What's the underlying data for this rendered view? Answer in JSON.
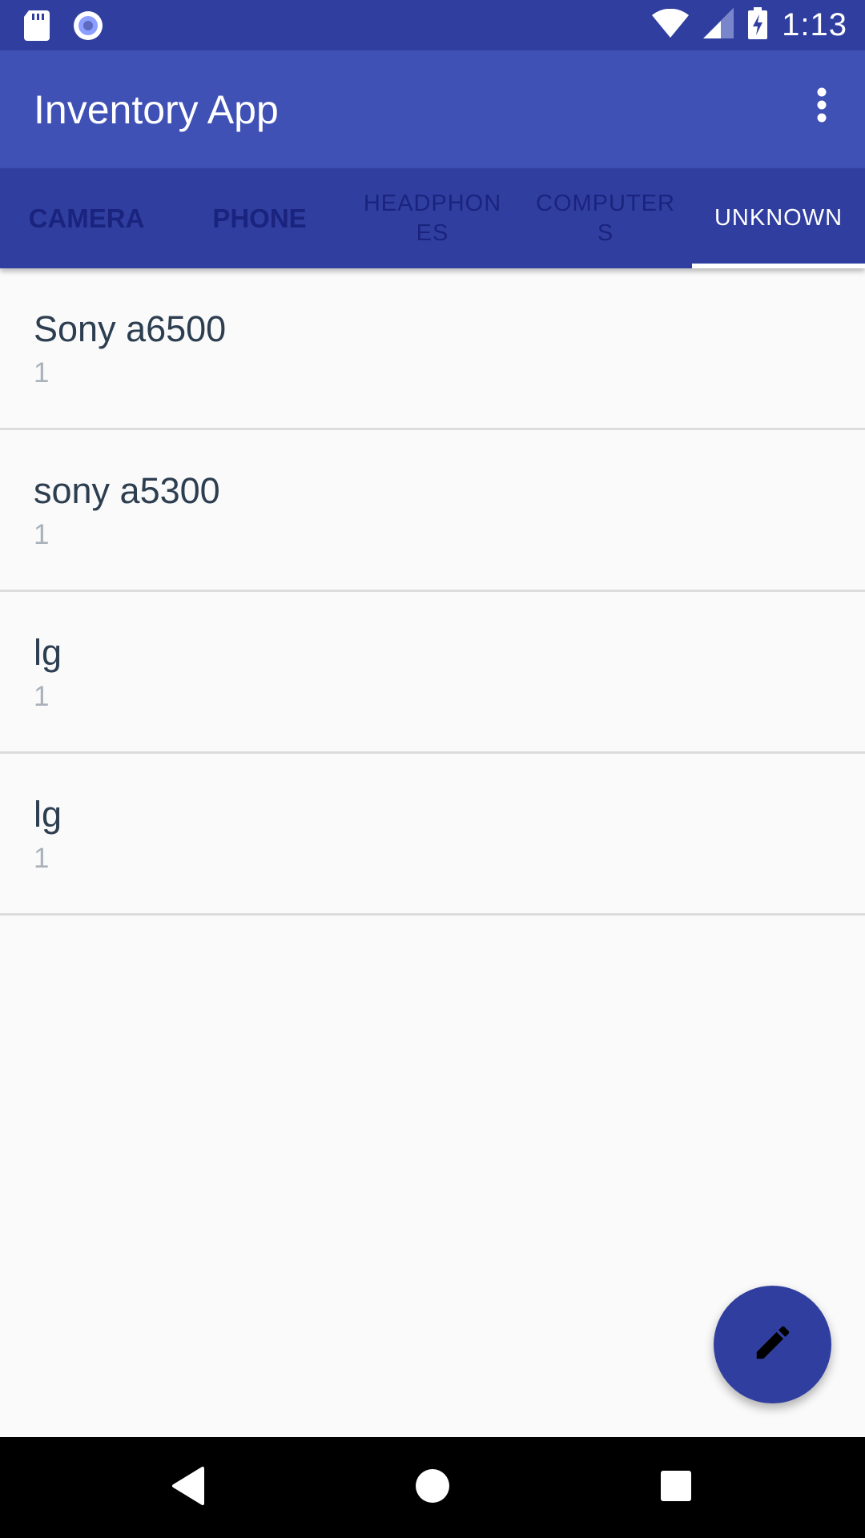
{
  "status_bar": {
    "time": "1:13",
    "icons": [
      "sd-card-icon",
      "record-icon",
      "wifi-icon",
      "cell-signal-icon",
      "battery-charging-icon"
    ]
  },
  "app_bar": {
    "title": "Inventory App",
    "overflow_icon": "more-vert-icon"
  },
  "tabs": [
    {
      "label": "CAMERA",
      "active": false
    },
    {
      "label": "PHONE",
      "active": false
    },
    {
      "label": "HEADPHONES",
      "active": false
    },
    {
      "label": "COMPUTERS",
      "active": false
    },
    {
      "label": "UNKNOWN",
      "active": true
    }
  ],
  "items": [
    {
      "name": "Sony a6500",
      "quantity": "1"
    },
    {
      "name": "sony a5300",
      "quantity": "1"
    },
    {
      "name": "lg",
      "quantity": "1"
    },
    {
      "name": "lg",
      "quantity": "1"
    }
  ],
  "fab": {
    "icon": "edit-pencil-icon"
  },
  "nav_bar": {
    "icons": [
      "back-icon",
      "home-icon",
      "recents-icon"
    ]
  },
  "colors": {
    "primary": "#3F51B5",
    "primary_dark": "#303F9F",
    "tab_inactive_text": "#1A237E",
    "background": "#FAFAFA"
  }
}
